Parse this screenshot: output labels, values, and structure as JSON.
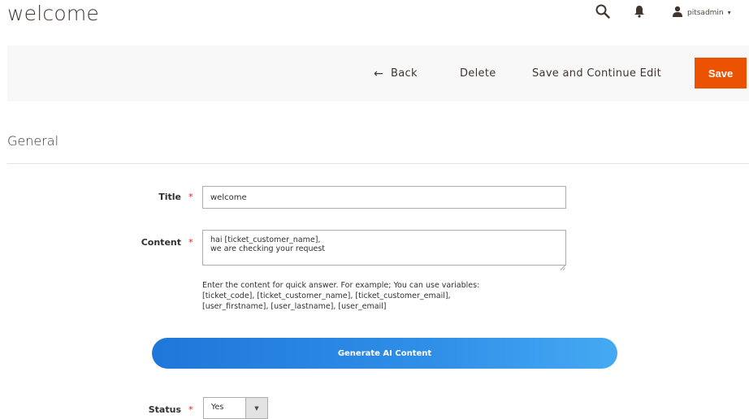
{
  "header": {
    "title": "welcome",
    "user_name": "pitsadmin",
    "icons": [
      "search-icon",
      "bell-icon",
      "user-icon"
    ]
  },
  "actions": {
    "back_label": "Back",
    "delete_label": "Delete",
    "save_continue_label": "Save and Continue Edit",
    "save_label": "Save"
  },
  "section": {
    "title": "General"
  },
  "form": {
    "title_label": "Title",
    "title_value": "welcome",
    "content_label": "Content",
    "content_value": "hai [ticket_customer_name],\nwe are checking your request",
    "content_note_line1": "Enter the content for quick answer. For example; You can use variables:",
    "content_note_line2": "[ticket_code], [ticket_customer_name], [ticket_customer_email],",
    "content_note_line3": "[user_firstname], [user_lastname], [user_email]",
    "generate_label": "Generate AI Content",
    "status_label": "Status",
    "status_value": "Yes",
    "required_mark": "*"
  },
  "colors": {
    "save_button": "#eb5202",
    "generate_button": "#2f8fe8",
    "required": "#e22626"
  }
}
